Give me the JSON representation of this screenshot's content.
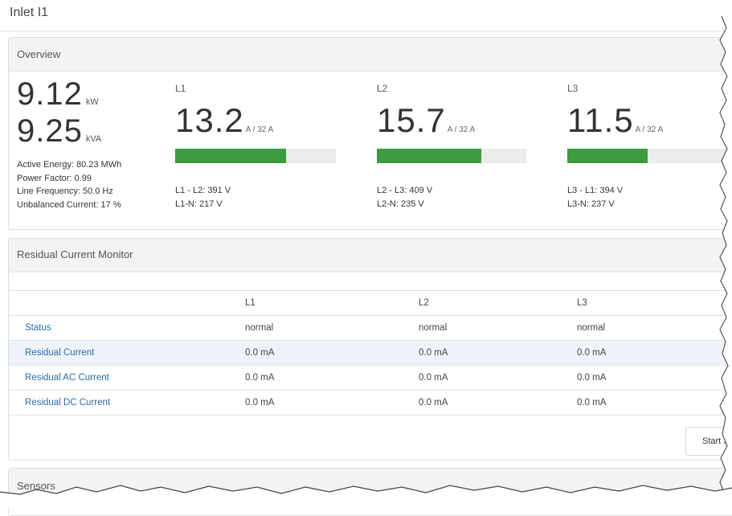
{
  "page": {
    "title": "Inlet I1"
  },
  "overview": {
    "heading": "Overview",
    "power": [
      {
        "value": "9.12",
        "unit": "kW"
      },
      {
        "value": "9.25",
        "unit": "kVA"
      }
    ],
    "stats": [
      "Active Energy: 80.23 MWh",
      "Power Factor: 0.99",
      "Line Frequency: 50.0 Hz",
      "Unbalanced Current: 17 %"
    ],
    "phases": [
      {
        "label": "L1",
        "current": "13.2",
        "max": "A / 32 A",
        "load_fraction": 0.6875,
        "line_voltage": "L1 - L2: 391 V",
        "neutral_voltage": "L1-N: 217 V"
      },
      {
        "label": "L2",
        "current": "15.7",
        "max": "A / 32 A",
        "load_fraction": 0.7,
        "line_voltage": "L2 - L3: 409 V",
        "neutral_voltage": "L2-N: 235 V"
      },
      {
        "label": "L3",
        "current": "11.5",
        "max": "A / 32 A",
        "load_fraction": 0.5,
        "line_voltage": "L3 - L1: 394 V",
        "neutral_voltage": "L3-N: 237 V"
      }
    ],
    "bar_color": "#3e9a3f"
  },
  "rcm": {
    "heading": "Residual Current Monitor",
    "columns": [
      "",
      "L1",
      "L2",
      "L3"
    ],
    "rows": [
      {
        "label": "Status",
        "values": [
          "normal",
          "normal",
          "normal"
        ]
      },
      {
        "label": "Residual Current",
        "values": [
          "0.0 mA",
          "0.0 mA",
          "0.0 mA"
        ]
      },
      {
        "label": "Residual AC Current",
        "values": [
          "0.0 mA",
          "0.0 mA",
          "0.0 mA"
        ]
      },
      {
        "label": "Residual DC Current",
        "values": [
          "0.0 mA",
          "0.0 mA",
          "0.0 mA"
        ]
      }
    ],
    "button_label": "Start S"
  },
  "sensors": {
    "heading": "Sensors"
  },
  "colors": {
    "link": "#2c6aa5",
    "row_highlight": "#eef3fa",
    "panel_heading_bg": "#f3f3f3"
  }
}
